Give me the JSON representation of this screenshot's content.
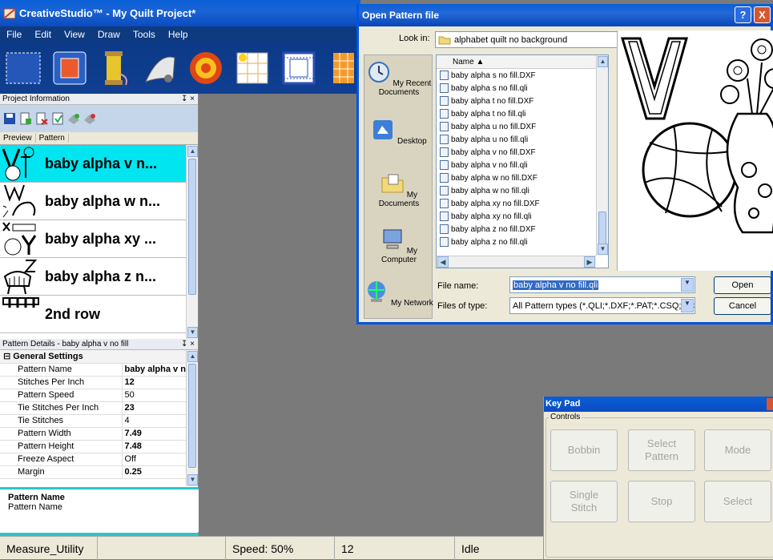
{
  "app": {
    "title": "CreativeStudio™ - My Quilt Project*",
    "menu": [
      "File",
      "Edit",
      "View",
      "Draw",
      "Tools",
      "Help"
    ],
    "toolbar_icons": [
      "select-rect-icon",
      "fill-rect-icon",
      "thread-spool-icon",
      "scroll-pattern-icon",
      "target-icon",
      "grid-icon",
      "border-grid-icon",
      "block-grid-icon"
    ]
  },
  "project_panel": {
    "caption": "Project Information",
    "pin": "ⅵ",
    "close": "×",
    "columns": [
      "Preview",
      "Pattern"
    ],
    "patterns": [
      {
        "name": "baby alpha v n...",
        "selected": true
      },
      {
        "name": "baby alpha w n...",
        "selected": false
      },
      {
        "name": "baby alpha xy ...",
        "selected": false
      },
      {
        "name": "baby alpha z n...",
        "selected": false
      },
      {
        "name": "2nd row",
        "selected": false
      }
    ]
  },
  "details_panel": {
    "caption": "Pattern Details - baby alpha v no fill",
    "group": "General Settings",
    "properties": [
      {
        "label": "Pattern Name",
        "value": "baby alpha v n"
      },
      {
        "label": "Stitches Per Inch",
        "value": "12"
      },
      {
        "label": "Pattern Speed",
        "value": "50"
      },
      {
        "label": "Tie Stitches Per Inch",
        "value": "23"
      },
      {
        "label": "Tie Stitches",
        "value": "4"
      },
      {
        "label": "Pattern Width",
        "value": "7.49"
      },
      {
        "label": "Pattern Height",
        "value": "7.48"
      },
      {
        "label": "Freeze Aspect",
        "value": "Off"
      },
      {
        "label": "Margin",
        "value": "0.25"
      }
    ],
    "desc_title": "Pattern Name",
    "desc_text": "Pattern Name"
  },
  "statusbar": {
    "utility": "Measure_Utility",
    "speed": "Speed: 50%",
    "stitches": "12",
    "state": "Idle"
  },
  "dialog": {
    "title": "Open Pattern file",
    "help": "?",
    "close": "X",
    "look_in_label": "Look in:",
    "look_in_value": "alphabet quilt no background",
    "places": [
      "My Recent Documents",
      "Desktop",
      "My Documents",
      "My Computer",
      "My Network"
    ],
    "list_header": "Name",
    "files": [
      "baby alpha s no fill.DXF",
      "baby alpha s no fill.qli",
      "baby alpha t no fill.DXF",
      "baby alpha t no fill.qli",
      "baby alpha u no fill.DXF",
      "baby alpha u no fill.qli",
      "baby alpha v no fill.DXF",
      "baby alpha v no fill.qli",
      "baby alpha w no fill.DXF",
      "baby alpha w no fill.qli",
      "baby alpha xy no fill.DXF",
      "baby alpha xy no fill.qli",
      "baby alpha z no fill.DXF",
      "baby alpha z no fill.qli"
    ],
    "file_name_label": "File name:",
    "file_name_value": "baby alpha v no fill.qli",
    "file_type_label": "Files of type:",
    "file_type_value": "All Pattern types (*.QLI;*.DXF;*.PAT;*.CSQ;*.CS",
    "open_label": "Open",
    "cancel_label": "Cancel"
  },
  "keypad": {
    "title": "Key Pad",
    "group": "Controls",
    "buttons": [
      "Bobbin",
      "Select\nPattern",
      "Mode",
      "Single\nStitch",
      "Stop",
      "Select"
    ]
  }
}
